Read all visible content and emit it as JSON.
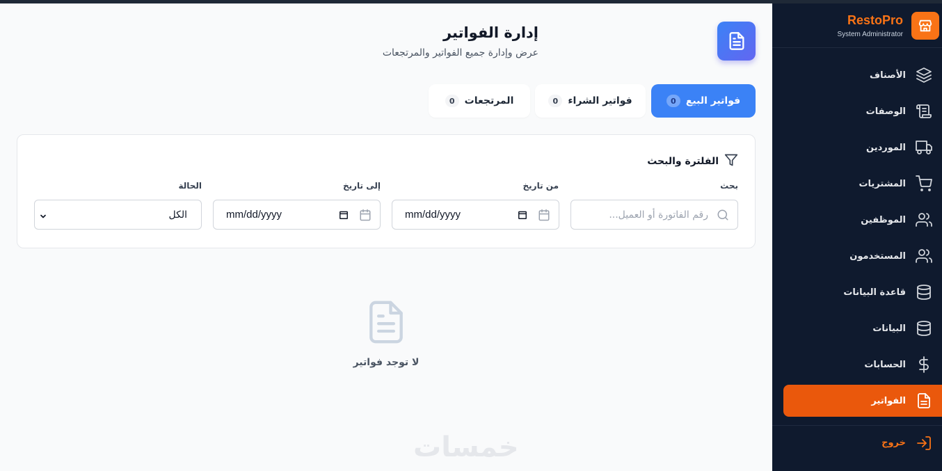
{
  "brand": {
    "name": "RestoPro",
    "role": "System Administrator"
  },
  "nav": [
    {
      "label": "الأصناف",
      "icon": "layers-icon"
    },
    {
      "label": "الوصفات",
      "icon": "scroll-icon"
    },
    {
      "label": "الموردين",
      "icon": "truck-icon"
    },
    {
      "label": "المشتريات",
      "icon": "cart-icon"
    },
    {
      "label": "الموظفين",
      "icon": "users-icon"
    },
    {
      "label": "المستخدمون",
      "icon": "users-icon"
    },
    {
      "label": "قاعدة البيانات",
      "icon": "database-icon"
    },
    {
      "label": "البيانات",
      "icon": "database-icon"
    },
    {
      "label": "الحسابات",
      "icon": "dollar-icon"
    },
    {
      "label": "الفواتير",
      "icon": "file-text-icon",
      "active": true
    }
  ],
  "logout": "خروج",
  "header": {
    "title": "إدارة الفواتير",
    "subtitle": "عرض وإدارة جميع الفواتير والمرتجعات"
  },
  "tabs": {
    "sales": {
      "label": "فواتير البيع",
      "count": "0"
    },
    "purchase": {
      "label": "فواتير الشراء",
      "count": "0"
    },
    "returns": {
      "label": "المرتجعات",
      "count": "0"
    }
  },
  "filters": {
    "title": "الفلترة والبحث",
    "search_label": "بحث",
    "search_placeholder": "رقم الفاتورة أو العميل...",
    "from_label": "من تاريخ",
    "from_value": "mm/dd/yyyy",
    "to_label": "إلى تاريخ",
    "to_value": "mm/dd/yyyy",
    "status_label": "الحالة",
    "status_value": "الكل"
  },
  "empty": {
    "text": "لا توجد فواتير"
  },
  "watermark": "خمسات",
  "colors": {
    "accent": "#f97316",
    "primary": "#3b82f6",
    "sidebar": "#0f1a2e"
  }
}
